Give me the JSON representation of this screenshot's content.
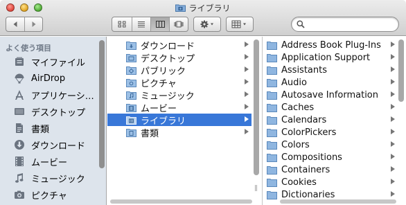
{
  "window": {
    "title": "ライブラリ"
  },
  "toolbar": {
    "back_icon": "chevron-left-icon",
    "forward_icon": "chevron-right-icon",
    "view_modes": [
      "icon-view",
      "list-view",
      "column-view",
      "coverflow-view"
    ],
    "active_view": "column-view",
    "action_icon": "gear-icon",
    "arrange_icon": "arrange-grid-icon",
    "search": {
      "value": "",
      "placeholder": ""
    }
  },
  "sidebar": {
    "heading": "よく使う項目",
    "items": [
      {
        "label": "マイファイル",
        "icon": "all-my-files-icon"
      },
      {
        "label": "AirDrop",
        "icon": "airdrop-icon"
      },
      {
        "label": "アプリケーシ…",
        "icon": "applications-icon"
      },
      {
        "label": "デスクトップ",
        "icon": "desktop-icon"
      },
      {
        "label": "書類",
        "icon": "documents-icon"
      },
      {
        "label": "ダウンロード",
        "icon": "downloads-icon"
      },
      {
        "label": "ムービー",
        "icon": "movies-icon"
      },
      {
        "label": "ミュージック",
        "icon": "music-icon"
      },
      {
        "label": "ピクチャ",
        "icon": "pictures-icon"
      }
    ]
  },
  "column1": {
    "items": [
      {
        "label": "ダウンロード",
        "selected": false
      },
      {
        "label": "デスクトップ",
        "selected": false
      },
      {
        "label": "パブリック",
        "selected": false
      },
      {
        "label": "ピクチャ",
        "selected": false
      },
      {
        "label": "ミュージック",
        "selected": false
      },
      {
        "label": "ムービー",
        "selected": false
      },
      {
        "label": "ライブラリ",
        "selected": true
      },
      {
        "label": "書類",
        "selected": false
      }
    ]
  },
  "column2": {
    "items": [
      {
        "label": "Address Book Plug-Ins"
      },
      {
        "label": "Application Support"
      },
      {
        "label": "Assistants"
      },
      {
        "label": "Audio"
      },
      {
        "label": "Autosave Information"
      },
      {
        "label": "Caches"
      },
      {
        "label": "Calendars"
      },
      {
        "label": "ColorPickers"
      },
      {
        "label": "Colors"
      },
      {
        "label": "Compositions"
      },
      {
        "label": "Containers"
      },
      {
        "label": "Cookies"
      },
      {
        "label": "Dictionaries"
      }
    ]
  },
  "colors": {
    "selection": "#3877d8",
    "sidebar_bg": "#dde4ec",
    "folder_blue": "#7fa9d6"
  }
}
